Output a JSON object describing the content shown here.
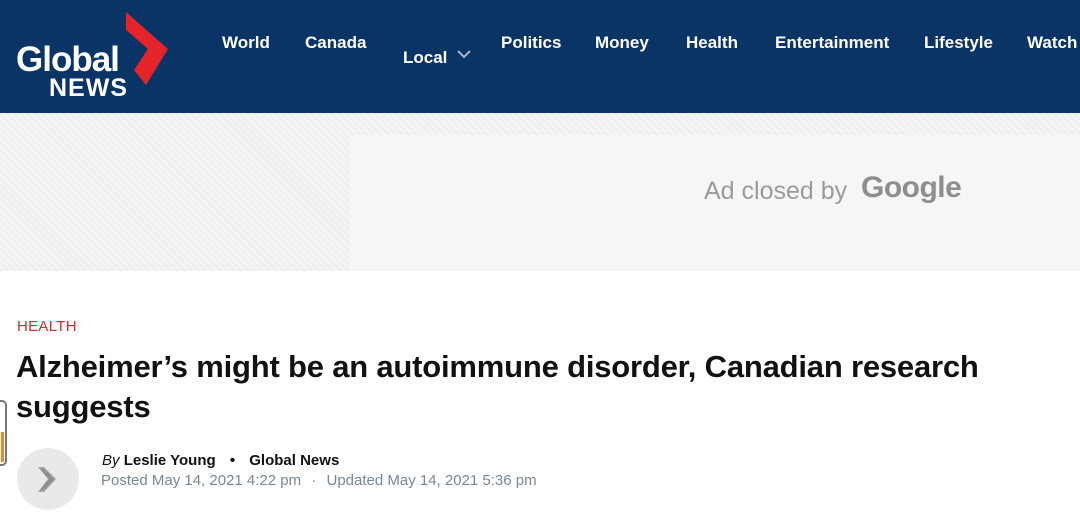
{
  "brand": {
    "logo_global": "Global",
    "logo_news": "NEWS",
    "header_color": "#0b3466",
    "accent_color": "#e4232b"
  },
  "nav": {
    "items": [
      "World",
      "Canada",
      "Local",
      "Politics",
      "Money",
      "Health",
      "Entertainment",
      "Lifestyle",
      "Watch"
    ],
    "local_dropdown_icon": "chevron-down-icon"
  },
  "ad": {
    "closed_text": "Ad closed by",
    "google": "Google"
  },
  "article": {
    "category": "HEALTH",
    "headline": "Alzheimer’s might be an autoimmune disorder, Canadian research suggests",
    "by_label": "By",
    "author": "Leslie Young",
    "source": "Global News",
    "posted": "Posted May 14, 2021 4:22 pm",
    "separator": "·",
    "updated": "Updated May 14, 2021 5:36 pm"
  }
}
